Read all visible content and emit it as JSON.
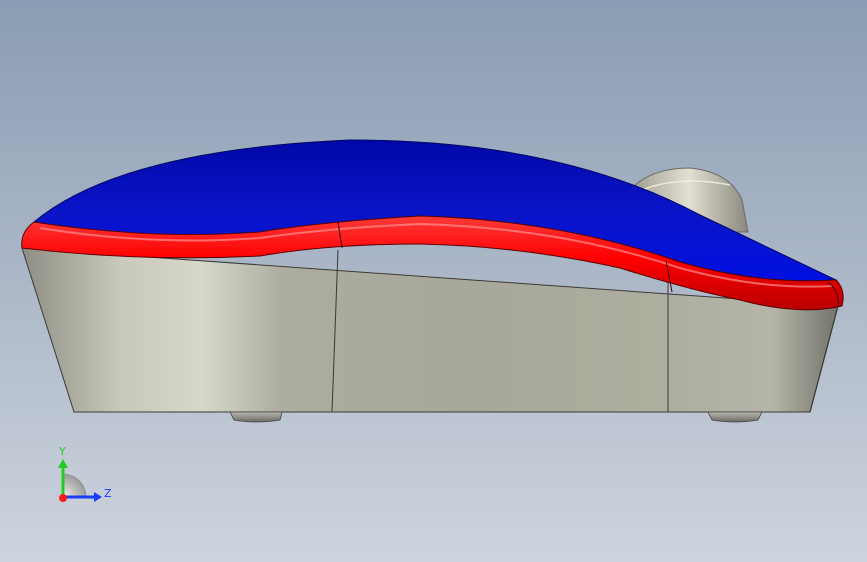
{
  "viewport": {
    "background_top": "#8a9cb3",
    "background_bottom": "#ced4dd"
  },
  "model": {
    "top_shell_color": "#0a14c8",
    "rim_color": "#ff0000",
    "body_color": "#b4b4a6",
    "wheel_color": "#d8d6c8",
    "feet_color": "#8c8c86"
  },
  "triad": {
    "y_label": "Y",
    "z_label": "Z",
    "y_color": "#22cc22",
    "z_color": "#1a3cff",
    "x_color": "#ff1a1a"
  }
}
